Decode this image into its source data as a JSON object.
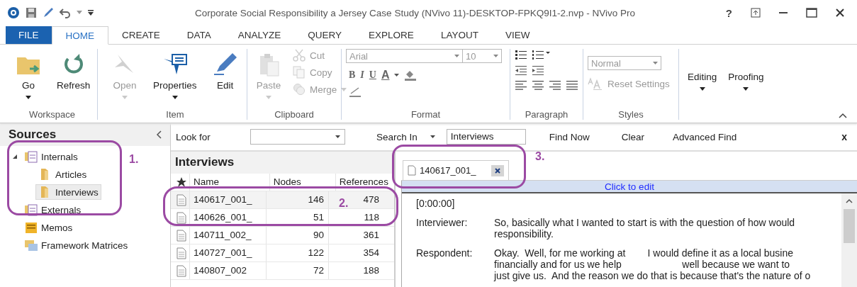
{
  "window": {
    "title": "Corporate Social Responsibility a Jersey Case Study (NVivo 11)-DESKTOP-FPKQ9I1-2.nvp - NVivo Pro",
    "help": "?"
  },
  "ribbon_tabs": [
    {
      "label": "FILE",
      "kind": "file",
      "selected": false
    },
    {
      "label": "HOME",
      "kind": "tab",
      "selected": true
    },
    {
      "label": "CREATE",
      "kind": "tab",
      "selected": false
    },
    {
      "label": "DATA",
      "kind": "tab",
      "selected": false
    },
    {
      "label": "ANALYZE",
      "kind": "tab",
      "selected": false
    },
    {
      "label": "QUERY",
      "kind": "tab",
      "selected": false
    },
    {
      "label": "EXPLORE",
      "kind": "tab",
      "selected": false
    },
    {
      "label": "LAYOUT",
      "kind": "tab",
      "selected": false
    },
    {
      "label": "VIEW",
      "kind": "tab",
      "selected": false
    }
  ],
  "ribbon_groups": [
    {
      "label": "Workspace",
      "items": [
        {
          "kind": "large",
          "label": "Go",
          "dropdown": true,
          "disabled": false
        },
        {
          "kind": "large",
          "label": "Refresh",
          "dropdown": false,
          "disabled": false
        }
      ]
    },
    {
      "label": "Item",
      "items": [
        {
          "kind": "large",
          "label": "Open",
          "dropdown": true,
          "disabled": true
        },
        {
          "kind": "large",
          "label": "Properties",
          "dropdown": true,
          "disabled": false
        },
        {
          "kind": "large",
          "label": "Edit",
          "dropdown": false,
          "disabled": false
        }
      ]
    },
    {
      "label": "Clipboard",
      "items": [
        {
          "kind": "large",
          "label": "Paste",
          "dropdown": true,
          "disabled": true
        },
        {
          "kind": "small",
          "label": "Cut",
          "dropdown": false,
          "disabled": true
        },
        {
          "kind": "small",
          "label": "Copy",
          "dropdown": false,
          "disabled": true
        },
        {
          "kind": "small",
          "label": "Merge",
          "dropdown": true,
          "disabled": true
        }
      ]
    },
    {
      "label": "Format",
      "items": [
        {
          "kind": "font",
          "value": "Arial",
          "size": "10",
          "disabled": true
        },
        {
          "kind": "styles",
          "labels": [
            "B",
            "I",
            "U",
            "A"
          ],
          "disabled": true
        }
      ]
    },
    {
      "label": "Paragraph",
      "items": [
        {
          "kind": "paragraph"
        }
      ]
    },
    {
      "label": "Styles",
      "items": [
        {
          "kind": "style_combo",
          "value": "Normal",
          "disabled": true
        },
        {
          "kind": "small",
          "label": "Reset Settings",
          "dropdown": false,
          "disabled": true
        }
      ]
    },
    {
      "items": [
        {
          "kind": "text_large",
          "label": "Editing",
          "dropdown": true,
          "disabled": false
        },
        {
          "kind": "text_large",
          "label": "Proofing",
          "dropdown": true,
          "disabled": false
        }
      ]
    }
  ],
  "sources": {
    "title": "Sources",
    "tree": [
      {
        "label": "Internals",
        "expanded": true,
        "selected": false,
        "children": [
          {
            "label": "Articles",
            "selected": false
          },
          {
            "label": "Interviews",
            "selected": true
          }
        ]
      },
      {
        "label": "Externals",
        "selected": false
      },
      {
        "label": "Memos",
        "selected": false
      },
      {
        "label": "Framework Matrices",
        "selected": false
      }
    ]
  },
  "find_bar": {
    "look_for_label": "Look for",
    "search_in_label": "Search In",
    "search_in_value": "Interviews",
    "buttons": [
      "Find Now",
      "Clear",
      "Advanced Find"
    ],
    "close": "x"
  },
  "list": {
    "title": "Interviews",
    "columns": [
      "Name",
      "Nodes",
      "References"
    ],
    "rows": [
      {
        "name": "140617_001_",
        "nodes": "146",
        "references": "478",
        "selected": true
      },
      {
        "name": "140626_001_",
        "nodes": "51",
        "references": "118",
        "selected": false
      },
      {
        "name": "140711_002_",
        "nodes": "90",
        "references": "361",
        "selected": false
      },
      {
        "name": "140727_001_",
        "nodes": "122",
        "references": "354",
        "selected": false
      },
      {
        "name": "140807_002",
        "nodes": "72",
        "references": "188",
        "selected": false
      }
    ]
  },
  "document": {
    "tab": "140617_001_",
    "edit_bar": "Click to edit",
    "timestamp": "[0:00:00]",
    "turns": [
      {
        "speaker": "Interviewer:",
        "lines": [
          "So, basically what I wanted to start is with the question of how would",
          "responsibility."
        ]
      },
      {
        "speaker": "Respondent:",
        "lines": [
          "Okay.  Well, for me working at        I would define it as a local busine",
          "financially and for us we help                      well because we want to",
          "just give us.  And the reason we do that is because that's the nature of o"
        ]
      }
    ]
  },
  "annotations": [
    {
      "label": "1."
    },
    {
      "label": "2."
    },
    {
      "label": "3."
    }
  ]
}
